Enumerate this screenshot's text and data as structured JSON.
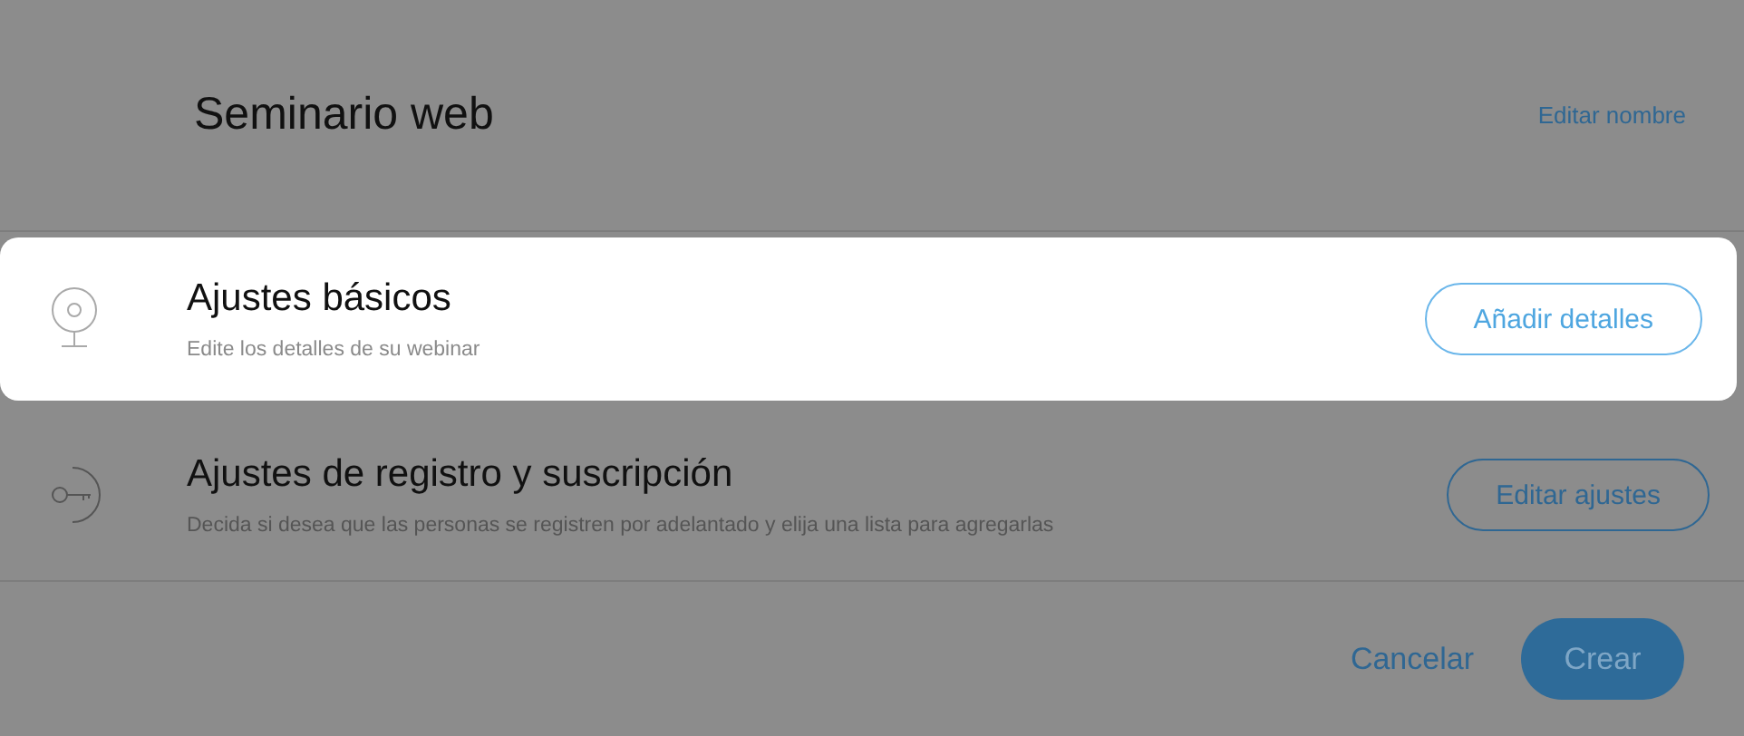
{
  "header": {
    "title": "Seminario web",
    "edit_link": "Editar nombre"
  },
  "sections": [
    {
      "kind": "webcam",
      "title": "Ajustes básicos",
      "description": "Edite los detalles de su webinar",
      "button": "Añadir detalles",
      "highlighted": true
    },
    {
      "kind": "key",
      "title": "Ajustes de registro y suscripción",
      "description": "Decida si desea que las personas se registren por adelantado y elija una lista para agregarlas",
      "button": "Editar ajustes",
      "highlighted": false
    }
  ],
  "footer": {
    "cancel": "Cancelar",
    "create": "Crear"
  }
}
